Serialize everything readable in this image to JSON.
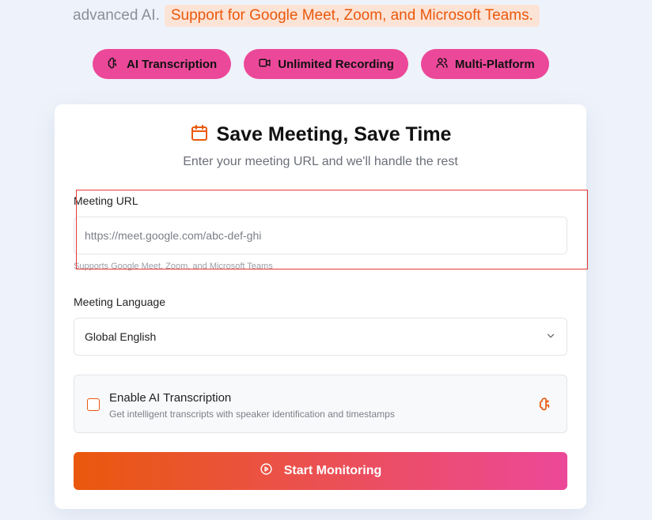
{
  "hero": {
    "line_text": "advanced AI.",
    "highlight_text": "Support for Google Meet, Zoom, and Microsoft Teams."
  },
  "features": [
    {
      "label": "AI Transcription",
      "icon": "brain-icon"
    },
    {
      "label": "Unlimited Recording",
      "icon": "video-camera-icon"
    },
    {
      "label": "Multi-Platform",
      "icon": "users-icon"
    }
  ],
  "card": {
    "title": "Save Meeting, Save Time",
    "title_icon": "calendar-icon",
    "subtitle": "Enter your meeting URL and we'll handle the rest"
  },
  "meeting_url": {
    "label": "Meeting URL",
    "placeholder": "https://meet.google.com/abc-def-ghi",
    "hint": "Supports Google Meet, Zoom, and Microsoft Teams"
  },
  "meeting_language": {
    "label": "Meeting Language",
    "selected": "Global English"
  },
  "transcription": {
    "title": "Enable AI Transcription",
    "description": "Get intelligent transcripts with speaker identification and timestamps",
    "checked": false
  },
  "start_button": {
    "label": "Start Monitoring",
    "icon": "play-circle-icon"
  },
  "colors": {
    "accent_orange": "#ea580c",
    "accent_pink": "#ec4899",
    "highlight_box": "#e53935"
  }
}
